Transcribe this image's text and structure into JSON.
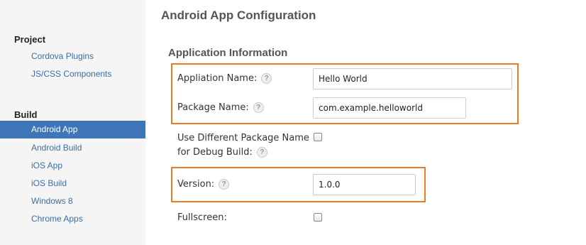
{
  "sidebar": {
    "project_title": "Project",
    "project_items": [
      "Cordova Plugins",
      "JS/CSS Components"
    ],
    "build_title": "Build",
    "build_items": [
      "Android App",
      "Android Build",
      "iOS App",
      "iOS Build",
      "Windows 8",
      "Chrome Apps"
    ],
    "active_item": "Android App"
  },
  "main": {
    "title": "Android App Configuration",
    "section_title": "Application Information",
    "fields": {
      "app_name": {
        "label": "Appliation Name:",
        "value": "Hello World"
      },
      "package_name": {
        "label": "Package Name:",
        "value": "com.example.helloworld"
      },
      "debug_package": {
        "label_line1": "Use Different Package Name",
        "label_line2": "for Debug Build:",
        "checked": false
      },
      "version": {
        "label": "Version:",
        "value": "1.0.0"
      },
      "fullscreen": {
        "label": "Fullscreen:",
        "checked": false
      }
    },
    "help_glyph": "?"
  },
  "colors": {
    "highlight": "#ee7a1f",
    "active_nav": "#3f76b8",
    "link": "#3a6ea5"
  },
  "icons": [
    "help-icon",
    "checkbox-icon"
  ]
}
